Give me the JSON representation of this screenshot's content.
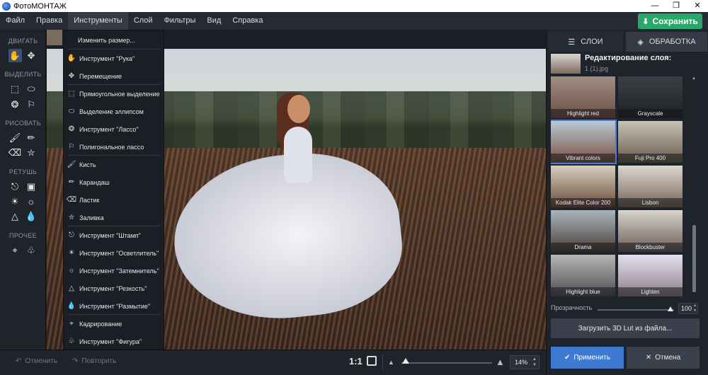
{
  "window": {
    "title": "ФотоМОНТАЖ",
    "minimize_icon": "minimize-icon",
    "maximize_icon": "maximize-icon",
    "close_icon": "close-icon"
  },
  "menu": [
    "Файл",
    "Правка",
    "Инструменты",
    "Слой",
    "Фильтры",
    "Вид",
    "Справка"
  ],
  "save_label": "Сохранить",
  "save_color": "#2aa86a",
  "tool_groups": {
    "move": "ДВИГАТЬ",
    "select": "ВЫДЕЛИТЬ",
    "draw": "РИСОВАТЬ",
    "retouch": "РЕТУШЬ",
    "other": "ПРОЧЕЕ"
  },
  "dropdown": {
    "items": [
      {
        "label": "Изменить размер...",
        "icon": ""
      },
      {
        "label": "Инструмент \"Рука\"",
        "icon": "hand-icon"
      },
      {
        "label": "Перемещение",
        "icon": "move-icon"
      },
      {
        "label": "Прямоугольное выделение",
        "icon": "rect-select-icon"
      },
      {
        "label": "Выделение эллипсом",
        "icon": "ellipse-select-icon"
      },
      {
        "label": "Инструмент \"Лассо\"",
        "icon": "lasso-icon"
      },
      {
        "label": "Полигональное лассо",
        "icon": "polygon-lasso-icon"
      },
      {
        "label": "Кисть",
        "icon": "brush-icon"
      },
      {
        "label": "Карандаш",
        "icon": "pencil-icon"
      },
      {
        "label": "Ластик",
        "icon": "eraser-icon"
      },
      {
        "label": "Заливка",
        "icon": "fill-icon"
      },
      {
        "label": "Инструмент \"Штамп\"",
        "icon": "stamp-icon"
      },
      {
        "label": "Инструмент \"Осветлитель\"",
        "icon": "dodge-icon"
      },
      {
        "label": "Инструмент \"Затемнитель\"",
        "icon": "burn-icon"
      },
      {
        "label": "Инструмент \"Резкость\"",
        "icon": "sharpen-icon"
      },
      {
        "label": "Инструмент \"Размытие\"",
        "icon": "blur-icon"
      },
      {
        "label": "Кадрирование",
        "icon": "crop-icon"
      },
      {
        "label": "Инструмент \"Фигура\"",
        "icon": "shape-icon"
      }
    ]
  },
  "bottom": {
    "undo": "Отменить",
    "redo": "Повторить",
    "ratio": "1:1",
    "zoom": "14%"
  },
  "right_panel": {
    "tab_layers": "СЛОИ",
    "tab_processing": "ОБРАБОТКА",
    "layer_title": "Редактирование слоя:",
    "layer_file": "1 (1).jpg",
    "filters": [
      "Highlight red",
      "Grayscale",
      "Vibrant colors",
      "Fuji Pro 400",
      "Kodak Elite Color 200",
      "Lisbon",
      "Drama",
      "Blockbuster",
      "Highlight blue",
      "Lighten"
    ],
    "selected_filter": "Vibrant colors",
    "opacity_label": "Прозрачность",
    "opacity_value": "100",
    "lut_button": "Загрузить 3D Lut из файла...",
    "apply": "Применить",
    "cancel": "Отмена",
    "apply_color": "#3e7ad1"
  }
}
